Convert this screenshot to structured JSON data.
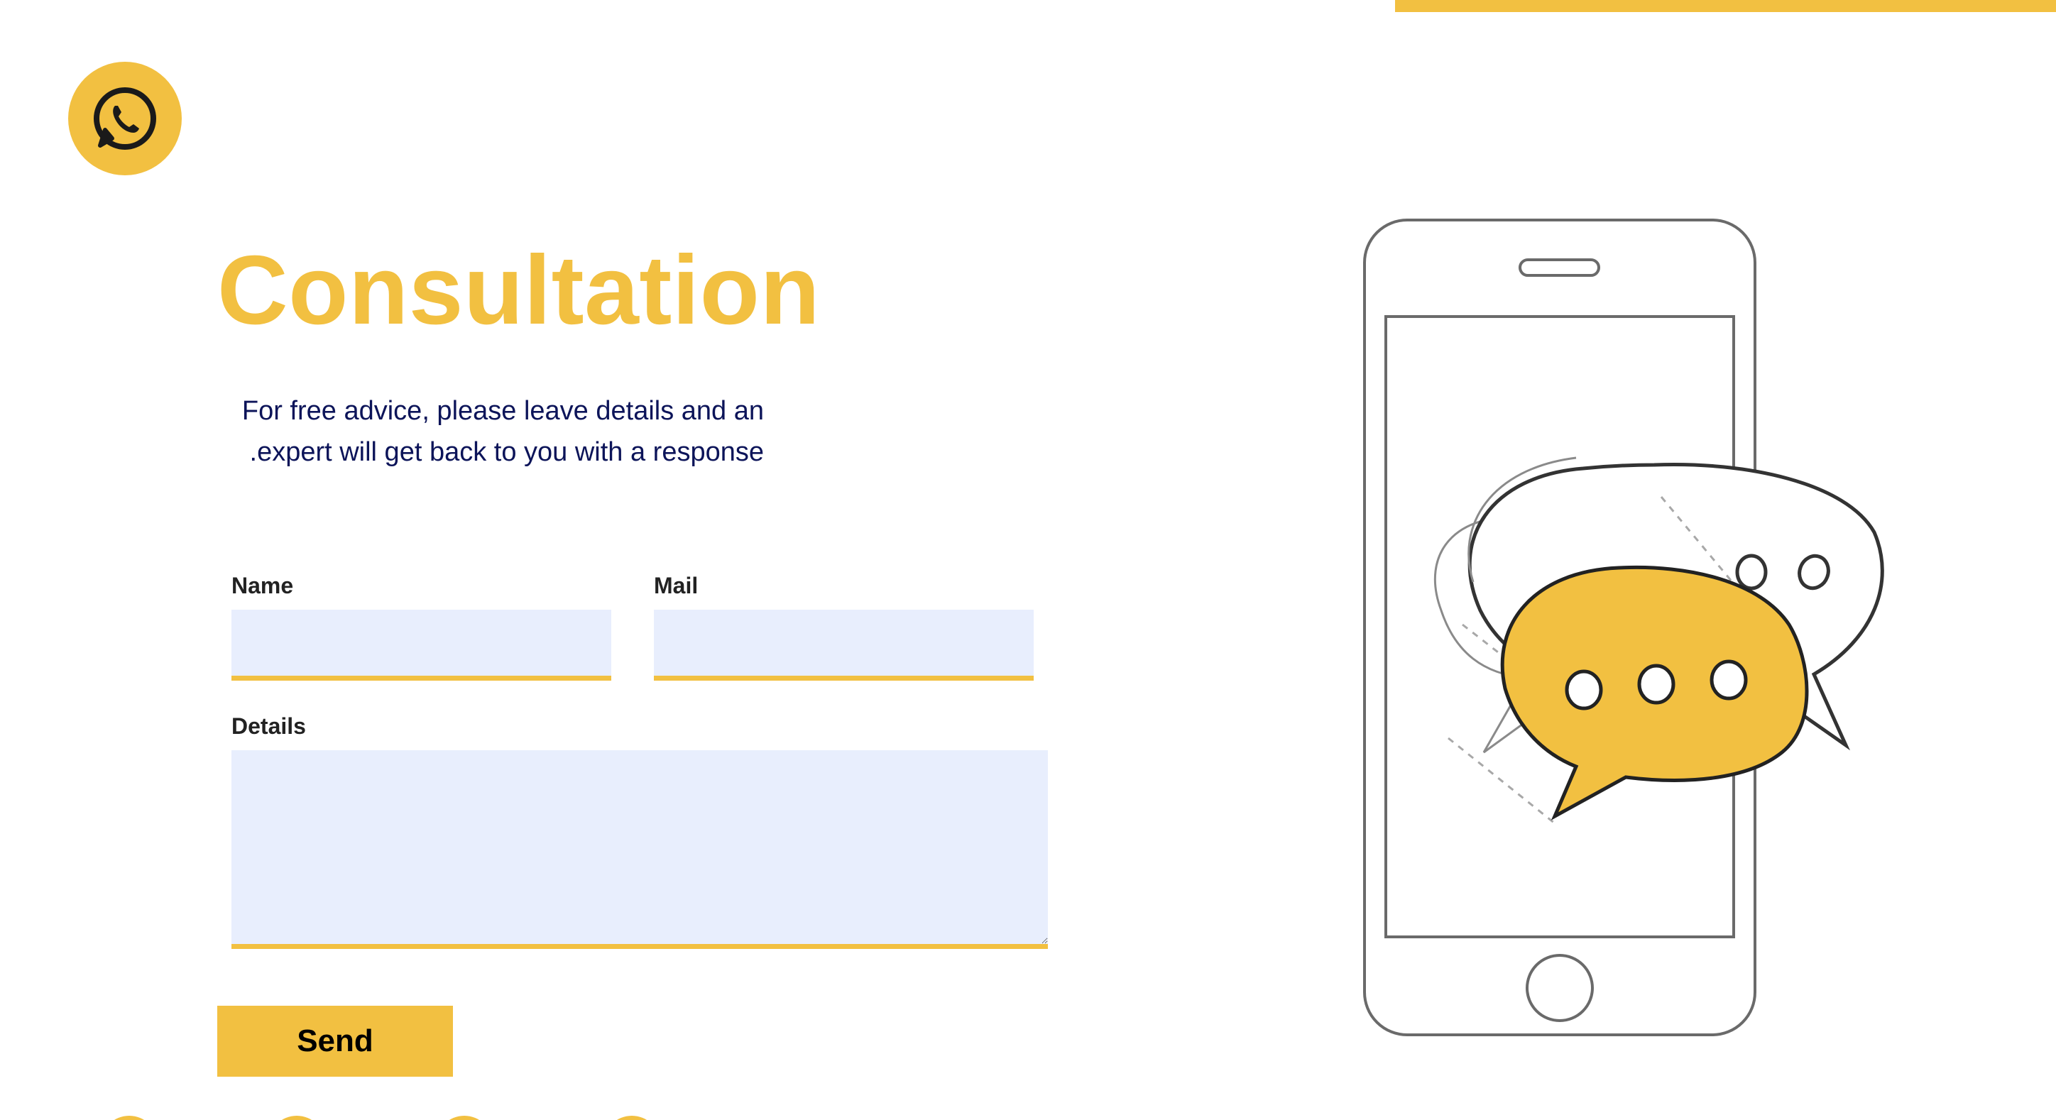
{
  "theme": {
    "accent": "#f2c041",
    "text_dark": "#0c1459",
    "input_bg": "#e8eefd"
  },
  "header": {
    "whatsapp_icon": "whatsapp-icon"
  },
  "main": {
    "title": "Consultation",
    "intro": "For free advice, please leave details and an expert will get back to you with a response."
  },
  "form": {
    "name_label": "Name",
    "mail_label": "Mail",
    "details_label": "Details",
    "name_value": "",
    "mail_value": "",
    "details_value": "",
    "send_label": "Send"
  },
  "illustration": {
    "icon": "phone-chat-bubbles-illustration"
  }
}
